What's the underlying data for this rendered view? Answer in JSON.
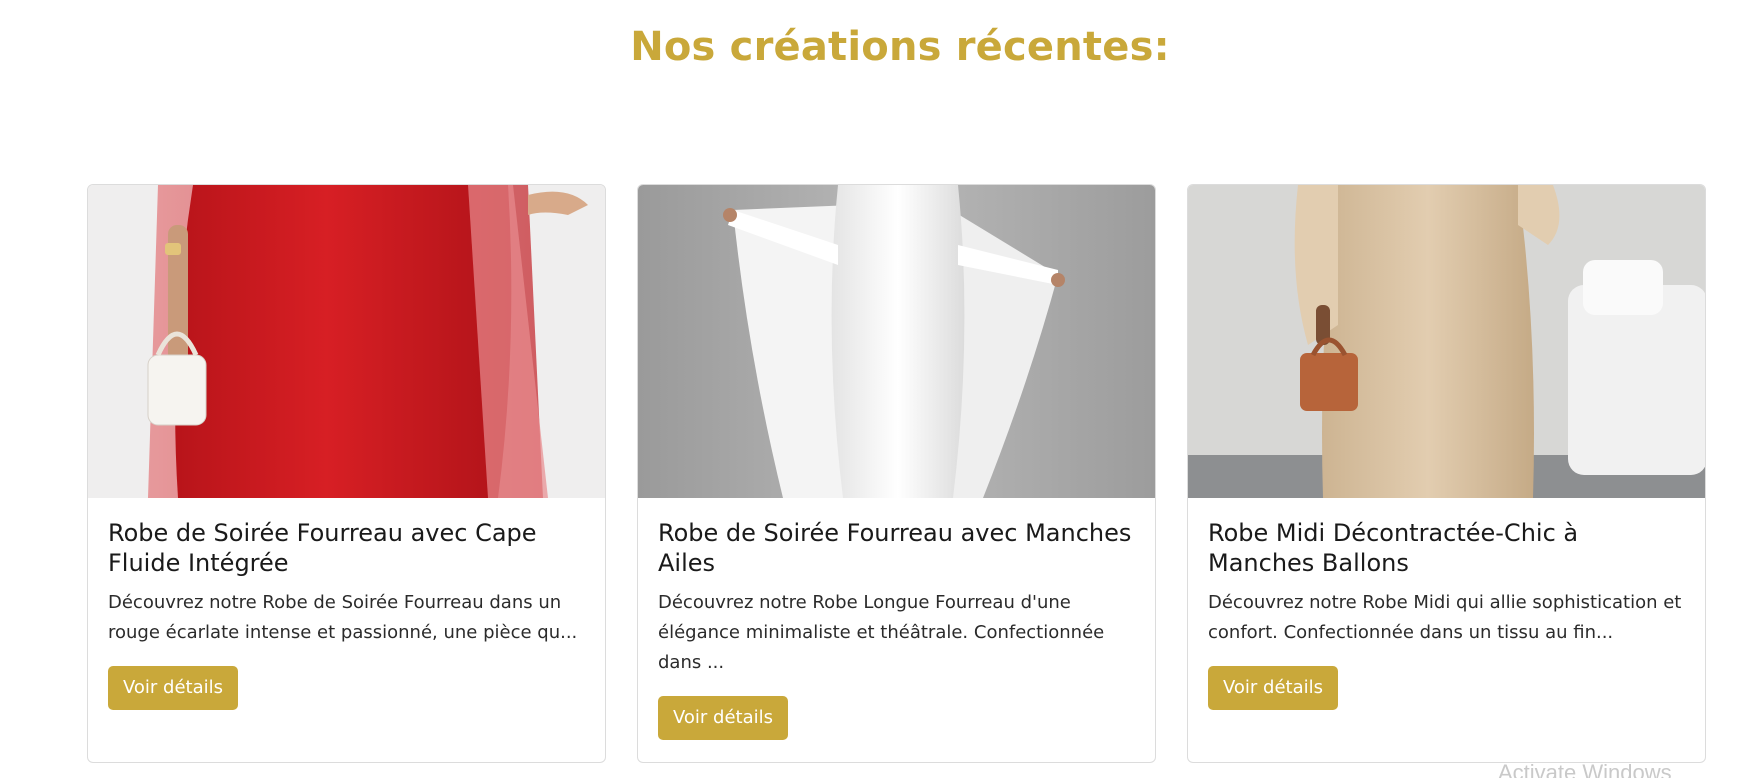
{
  "section": {
    "title": "Nos créations récentes:"
  },
  "colors": {
    "accent": "#c9a83a",
    "card_border": "#dcdcdc"
  },
  "cards": [
    {
      "title": "Robe de Soirée Fourreau avec Cape Fluide Intégrée",
      "description": "Découvrez notre Robe de Soirée Fourreau dans un rouge écarlate intense et passionné, une pièce qu...",
      "button_label": "Voir détails",
      "image_alt": "red-fitted-gown-with-cape-photo"
    },
    {
      "title": "Robe de Soirée Fourreau avec Manches Ailes",
      "description": "Découvrez notre Robe Longue Fourreau d'une élégance minimaliste et théâtrale. Confectionnée dans ...",
      "button_label": "Voir détails",
      "image_alt": "white-gown-with-wing-sleeves-photo"
    },
    {
      "title": "Robe Midi Décontractée-Chic à Manches Ballons",
      "description": "Découvrez notre Robe Midi qui allie sophistication et confort. Confectionnée dans un tissu au fin...",
      "button_label": "Voir détails",
      "image_alt": "beige-midi-dress-with-balloon-sleeves-photo"
    }
  ],
  "os_overlay": {
    "watermark": "Activate Windows"
  }
}
